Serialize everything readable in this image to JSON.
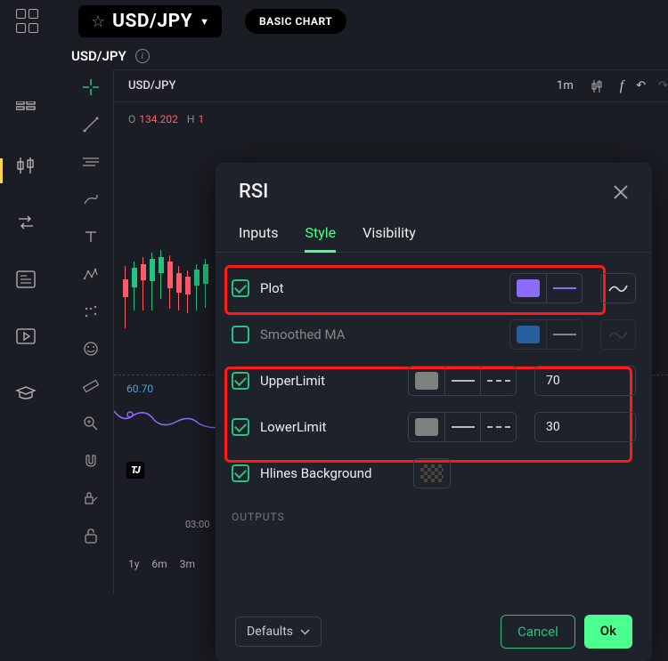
{
  "header": {
    "symbol": "USD/JPY",
    "basic_chart": "BASIC CHART",
    "sub_symbol": "USD/JPY"
  },
  "chart": {
    "title": "USD/JPY",
    "timeframe": "1m",
    "ohlc_o_label": "O",
    "ohlc_o_val": "134.202",
    "ohlc_h_label": "H",
    "ohlc_h_val": "1",
    "rsi_val": "60.70",
    "time_axis": "03:00",
    "tf_1y": "1y",
    "tf_6m": "6m",
    "tf_3m": "3m"
  },
  "dialog": {
    "title": "RSI",
    "tabs": {
      "inputs": "Inputs",
      "style": "Style",
      "visibility": "Visibility"
    },
    "rows": {
      "plot": "Plot",
      "smoothed": "Smoothed MA",
      "upper": "UpperLimit",
      "lower": "LowerLimit",
      "hlines": "Hlines Background"
    },
    "values": {
      "upper": "70",
      "lower": "30"
    },
    "outputs_label": "OUTPUTS",
    "defaults": "Defaults",
    "cancel": "Cancel",
    "ok": "Ok"
  }
}
